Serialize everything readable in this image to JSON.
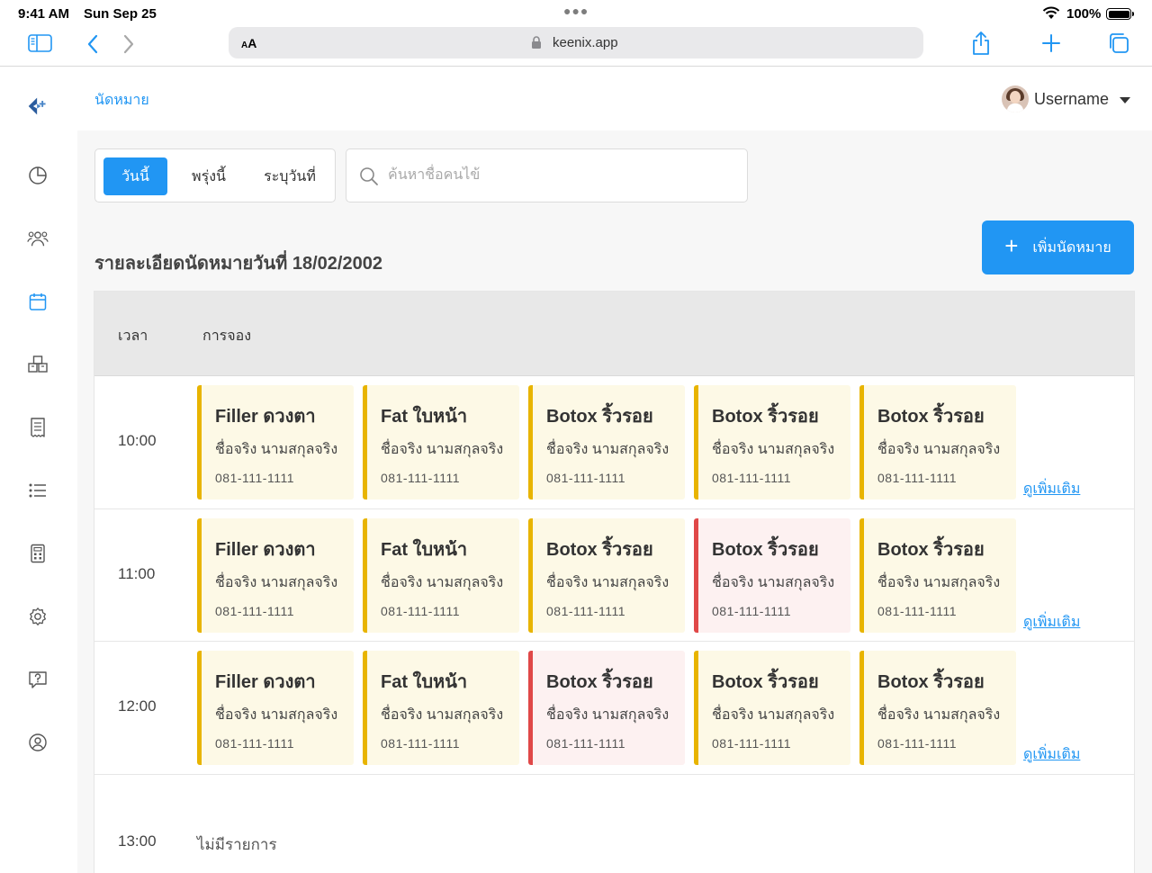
{
  "status_bar": {
    "time": "9:41 AM",
    "date": "Sun Sep 25",
    "battery": "100%"
  },
  "browser": {
    "text_size_label_small": "A",
    "text_size_label_large": "A",
    "url": "keenix.app",
    "icons": [
      "sidebar-toggle-icon",
      "back-icon",
      "forward-icon",
      "lock-icon",
      "share-icon",
      "new-tab-icon",
      "tabs-icon"
    ]
  },
  "sidebar": {
    "icons": [
      "logo-icon",
      "dashboard-icon",
      "users-icon",
      "calendar-icon",
      "inventory-icon",
      "receipt-icon",
      "list-icon",
      "calculator-icon",
      "settings-icon",
      "help-icon",
      "profile-icon"
    ],
    "active": "calendar-icon"
  },
  "header": {
    "breadcrumb": "นัดหมาย",
    "username": "Username"
  },
  "filters": {
    "today": "วันนี้",
    "tomorrow": "พรุ่งนี้",
    "pick_date": "ระบุวันที่"
  },
  "search": {
    "placeholder": "ค้นหาชื่อคนไข้"
  },
  "add_button": "เพิ่มนัดหมาย",
  "page_title": "รายละเอียดนัดหมายวันที่ 18/02/2002",
  "table": {
    "col_time": "เวลา",
    "col_booking": "การจอง",
    "more_label": "ดูเพิ่มเติม",
    "rows": [
      {
        "time": "10:00",
        "cards": [
          {
            "title": "Filler ดวงตา",
            "name": "ชื่อจริง นามสกุลจริง",
            "phone": "081-111-1111",
            "status": "normal"
          },
          {
            "title": "Fat ใบหน้า",
            "name": "ชื่อจริง นามสกุลจริง",
            "phone": "081-111-1111",
            "status": "normal"
          },
          {
            "title": "Botox ริ้วรอย",
            "name": "ชื่อจริง นามสกุลจริง",
            "phone": "081-111-1111",
            "status": "normal"
          },
          {
            "title": "Botox ริ้วรอย",
            "name": "ชื่อจริง นามสกุลจริง",
            "phone": "081-111-1111",
            "status": "normal"
          },
          {
            "title": "Botox ริ้วรอย",
            "name": "ชื่อจริง นามสกุลจริง",
            "phone": "081-111-1111",
            "status": "normal"
          }
        ]
      },
      {
        "time": "11:00",
        "cards": [
          {
            "title": "Filler ดวงตา",
            "name": "ชื่อจริง นามสกุลจริง",
            "phone": "081-111-1111",
            "status": "normal"
          },
          {
            "title": "Fat ใบหน้า",
            "name": "ชื่อจริง นามสกุลจริง",
            "phone": "081-111-1111",
            "status": "normal"
          },
          {
            "title": "Botox ริ้วรอย",
            "name": "ชื่อจริง นามสกุลจริง",
            "phone": "081-111-1111",
            "status": "normal"
          },
          {
            "title": "Botox ริ้วรอย",
            "name": "ชื่อจริง นามสกุลจริง",
            "phone": "081-111-1111",
            "status": "urgent"
          },
          {
            "title": "Botox ริ้วรอย",
            "name": "ชื่อจริง นามสกุลจริง",
            "phone": "081-111-1111",
            "status": "normal"
          }
        ]
      },
      {
        "time": "12:00",
        "cards": [
          {
            "title": "Filler ดวงตา",
            "name": "ชื่อจริง นามสกุลจริง",
            "phone": "081-111-1111",
            "status": "normal"
          },
          {
            "title": "Fat ใบหน้า",
            "name": "ชื่อจริง นามสกุลจริง",
            "phone": "081-111-1111",
            "status": "normal"
          },
          {
            "title": "Botox ริ้วรอย",
            "name": "ชื่อจริง นามสกุลจริง",
            "phone": "081-111-1111",
            "status": "urgent"
          },
          {
            "title": "Botox ริ้วรอย",
            "name": "ชื่อจริง นามสกุลจริง",
            "phone": "081-111-1111",
            "status": "normal"
          },
          {
            "title": "Botox ริ้วรอย",
            "name": "ชื่อจริง นามสกุลจริง",
            "phone": "081-111-1111",
            "status": "normal"
          }
        ]
      }
    ],
    "empty_row": {
      "time": "13:00",
      "text": "ไม่มีรายการ"
    }
  },
  "colors": {
    "accent": "#2196f3",
    "card_normal_bg": "#fdf9e6",
    "card_normal_border": "#e8b400",
    "card_urgent_bg": "#fdf1f1",
    "card_urgent_border": "#e04848"
  }
}
